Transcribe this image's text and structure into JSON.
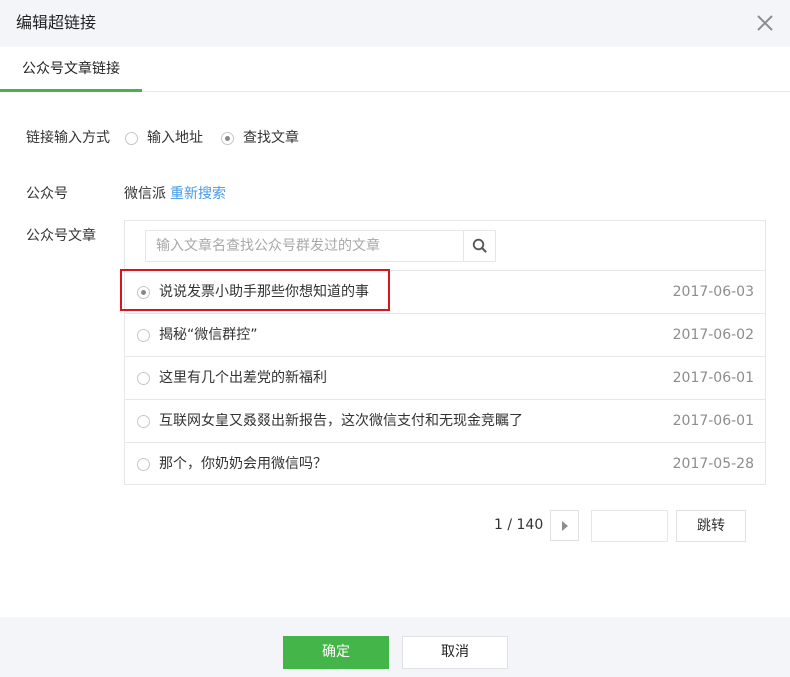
{
  "dialog": {
    "title": "编辑超链接",
    "close_icon": "close-icon"
  },
  "tabs": [
    {
      "label": "公众号文章链接",
      "active": true
    }
  ],
  "link_input_mode": {
    "label": "链接输入方式",
    "options": [
      {
        "label": "输入地址",
        "selected": false
      },
      {
        "label": "查找文章",
        "selected": true
      }
    ]
  },
  "account": {
    "label": "公众号",
    "name": "微信派",
    "research_label": "重新搜索"
  },
  "articles": {
    "label": "公众号文章",
    "search_placeholder": "输入文章名查找公众号群发过的文章",
    "search_icon": "search-icon",
    "items": [
      {
        "title": "说说发票小助手那些你想知道的事",
        "date": "2017-06-03",
        "selected": true
      },
      {
        "title": "揭秘“微信群控”",
        "date": "2017-06-02",
        "selected": false
      },
      {
        "title": "这里有几个出差党的新福利",
        "date": "2017-06-01",
        "selected": false
      },
      {
        "title": "互联网女皇又叒叕出新报告，这次微信支付和无现金竞瞩了",
        "date": "2017-06-01",
        "selected": false
      },
      {
        "title": "那个，你奶奶会用微信吗？",
        "date": "2017-05-28",
        "selected": false
      }
    ]
  },
  "pagination": {
    "page_text": "1 / 140",
    "next_icon": "chevron-right-icon",
    "goto_value": "",
    "goto_label": "跳转"
  },
  "footer": {
    "confirm_label": "确定",
    "cancel_label": "取消"
  },
  "colors": {
    "accent_green": "#44b549",
    "link_blue": "#459ae9",
    "highlight_red": "#d9161c",
    "header_bg": "#f4f5f9"
  }
}
